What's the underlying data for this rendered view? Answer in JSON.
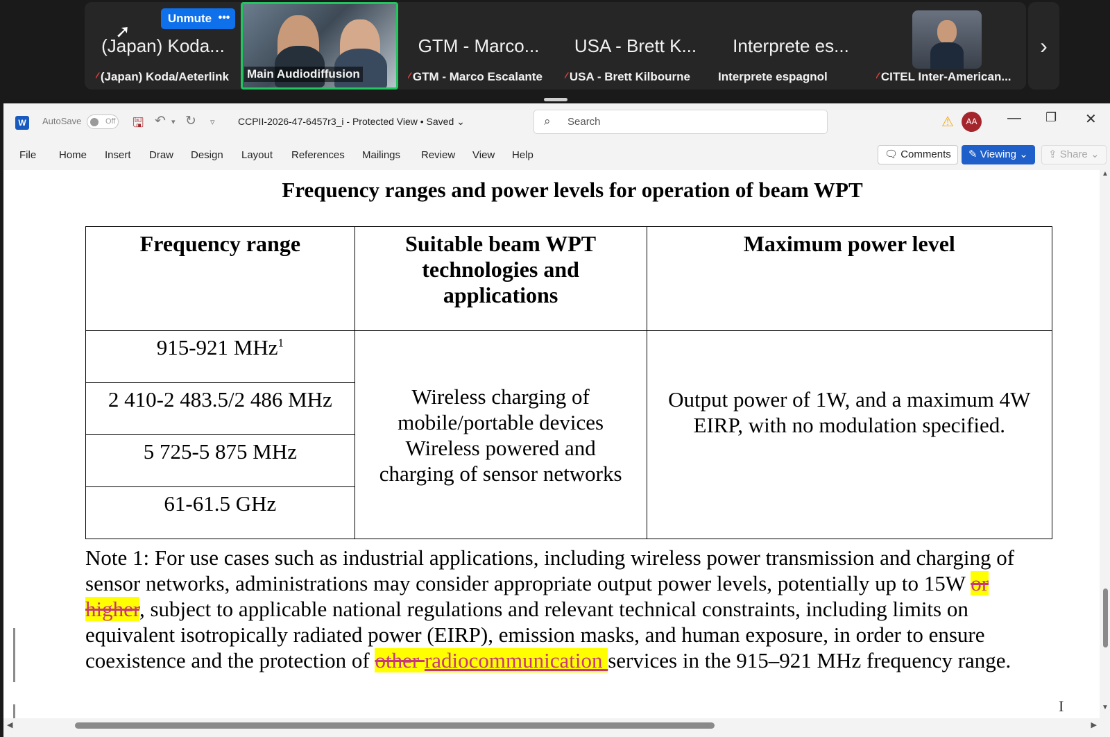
{
  "zoom": {
    "unmute_label": "Unmute",
    "more_label": "•••",
    "participants": [
      {
        "name": "(Japan) Koda...",
        "caption": "(Japan) Koda/Aeterlink",
        "muted": true
      },
      {
        "name": "",
        "caption": "Main Audiodiffusion",
        "muted": false
      },
      {
        "name": "GTM - Marco...",
        "caption": "GTM - Marco Escalante",
        "muted": true
      },
      {
        "name": "USA - Brett K...",
        "caption": "USA - Brett Kilbourne",
        "muted": true
      },
      {
        "name": "Interprete es...",
        "caption": "Interprete espagnol",
        "muted": false
      },
      {
        "name": "",
        "caption": "CITEL Inter-American...",
        "muted": true
      }
    ],
    "next_arrow": "›"
  },
  "word": {
    "logo": "W",
    "autosave_label": "AutoSave",
    "autosave_state": "Off",
    "doc_name": "CCPII-2026-47-6457r3_i  -  Protected View • Saved",
    "search_placeholder": "Search",
    "user_initials": "AA",
    "menu": [
      "File",
      "Home",
      "Insert",
      "Draw",
      "Design",
      "Layout",
      "References",
      "Mailings",
      "Review",
      "View",
      "Help"
    ],
    "comments_label": "Comments",
    "viewing_label": "Viewing",
    "share_label": "Share"
  },
  "document": {
    "title": "Frequency ranges and power levels for operation of beam WPT",
    "headers": [
      "Frequency range",
      "Suitable beam WPT technologies and applications",
      "Maximum power level"
    ],
    "frequency_ranges": [
      {
        "text": "915-921 MHz",
        "sup": "1"
      },
      {
        "text": "2 410-2 483.5/2 486 MHz",
        "sup": ""
      },
      {
        "text": "5 725-5 875 MHz",
        "sup": ""
      },
      {
        "text": "61-61.5 GHz",
        "sup": ""
      }
    ],
    "applications_line1": "Wireless charging of mobile/portable devices",
    "applications_line2": "Wireless powered and charging of sensor networks",
    "max_power": "Output power of 1W, and a maximum 4W EIRP, with no modulation specified.",
    "note": {
      "part1": " Note 1: For use cases such as industrial applications, including wireless power transmission and charging of sensor networks, administrations may consider appropriate output power levels, potentially up to 15W ",
      "deleted1": "or higher",
      "part2": ", subject to applicable national regulations and relevant technical constraints, including limits on equivalent isotropically radiated power (EIRP), emission masks, and human exposure, in order to ensure coexistence and the protection of ",
      "deleted2": "other ",
      "inserted": "radiocommunication ",
      "part3": "services in the 915–921 MHz frequency range."
    }
  },
  "colors": {
    "highlight": "#ffff00",
    "tracked_change": "#c8377a",
    "zoom_blue": "#0e71eb",
    "active_speaker": "#22c55e"
  }
}
